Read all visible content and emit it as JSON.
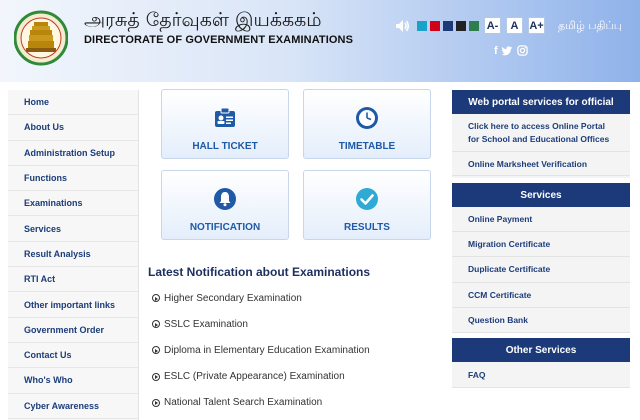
{
  "header": {
    "title_tamil": "அரசுத் தேர்வுகள் இயக்ககம்",
    "title_en": "DIRECTORATE OF GOVERNMENT EXAMINATIONS",
    "language_link": "தமிழ் பதிப்பு",
    "font_buttons": [
      "A-",
      "A",
      "A+"
    ],
    "theme_colors": [
      "#1aa2c9",
      "#d0021b",
      "#1c3a7a",
      "#222222",
      "#2e7d4f"
    ],
    "speaker_icon": "speaker-icon",
    "social": [
      "f",
      "twitter",
      "instagram"
    ]
  },
  "nav": {
    "items": [
      "Home",
      "About Us",
      "Administration Setup",
      "Functions",
      "Examinations",
      "Services",
      "Result Analysis",
      "RTI Act",
      "Other important links",
      "Government Order",
      "Contact Us",
      "Who's Who",
      "Cyber Awareness"
    ]
  },
  "tiles": [
    {
      "label": "HALL TICKET",
      "icon": "id-card-icon"
    },
    {
      "label": "TIMETABLE",
      "icon": "clock-icon"
    },
    {
      "label": "NOTIFICATION",
      "icon": "bell-icon"
    },
    {
      "label": "RESULTS",
      "icon": "check-circle-icon"
    }
  ],
  "notifications": {
    "title": "Latest Notification about Examinations",
    "items": [
      "Higher Secondary Examination",
      "SSLC Examination",
      "Diploma in Elementary Education Examination",
      "ESLC (Private Appearance) Examination",
      "National Talent Search Examination"
    ]
  },
  "panels": {
    "portal": {
      "title": "Web portal services for official",
      "links": [
        "Click here to access Online Portal for School and Educational Offices",
        "Online Marksheet Verification"
      ]
    },
    "services": {
      "title": "Services",
      "links": [
        "Online Payment",
        "Migration Certificate",
        "Duplicate Certificate",
        "CCM Certificate",
        "Question Bank"
      ]
    },
    "other": {
      "title": "Other Services",
      "links": [
        "FAQ"
      ]
    }
  }
}
